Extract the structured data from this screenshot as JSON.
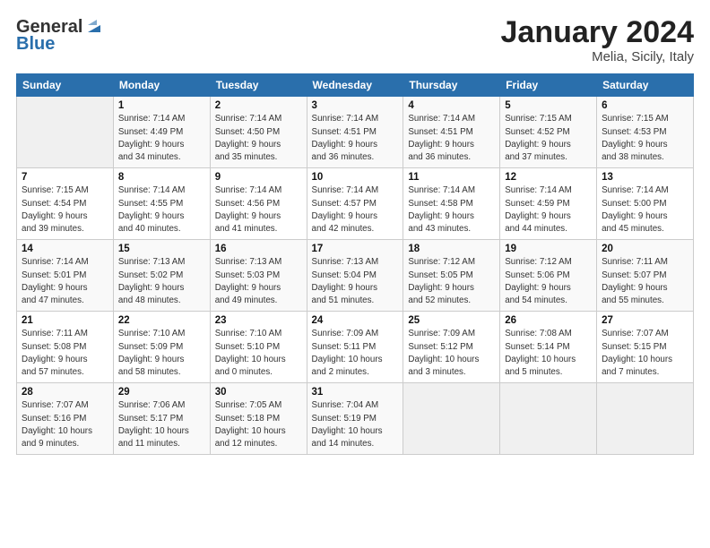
{
  "header": {
    "logo_general": "General",
    "logo_blue": "Blue",
    "title": "January 2024",
    "location": "Melia, Sicily, Italy"
  },
  "columns": [
    "Sunday",
    "Monday",
    "Tuesday",
    "Wednesday",
    "Thursday",
    "Friday",
    "Saturday"
  ],
  "weeks": [
    [
      {
        "day": "",
        "info": ""
      },
      {
        "day": "1",
        "info": "Sunrise: 7:14 AM\nSunset: 4:49 PM\nDaylight: 9 hours\nand 34 minutes."
      },
      {
        "day": "2",
        "info": "Sunrise: 7:14 AM\nSunset: 4:50 PM\nDaylight: 9 hours\nand 35 minutes."
      },
      {
        "day": "3",
        "info": "Sunrise: 7:14 AM\nSunset: 4:51 PM\nDaylight: 9 hours\nand 36 minutes."
      },
      {
        "day": "4",
        "info": "Sunrise: 7:14 AM\nSunset: 4:51 PM\nDaylight: 9 hours\nand 36 minutes."
      },
      {
        "day": "5",
        "info": "Sunrise: 7:15 AM\nSunset: 4:52 PM\nDaylight: 9 hours\nand 37 minutes."
      },
      {
        "day": "6",
        "info": "Sunrise: 7:15 AM\nSunset: 4:53 PM\nDaylight: 9 hours\nand 38 minutes."
      }
    ],
    [
      {
        "day": "7",
        "info": "Sunrise: 7:15 AM\nSunset: 4:54 PM\nDaylight: 9 hours\nand 39 minutes."
      },
      {
        "day": "8",
        "info": "Sunrise: 7:14 AM\nSunset: 4:55 PM\nDaylight: 9 hours\nand 40 minutes."
      },
      {
        "day": "9",
        "info": "Sunrise: 7:14 AM\nSunset: 4:56 PM\nDaylight: 9 hours\nand 41 minutes."
      },
      {
        "day": "10",
        "info": "Sunrise: 7:14 AM\nSunset: 4:57 PM\nDaylight: 9 hours\nand 42 minutes."
      },
      {
        "day": "11",
        "info": "Sunrise: 7:14 AM\nSunset: 4:58 PM\nDaylight: 9 hours\nand 43 minutes."
      },
      {
        "day": "12",
        "info": "Sunrise: 7:14 AM\nSunset: 4:59 PM\nDaylight: 9 hours\nand 44 minutes."
      },
      {
        "day": "13",
        "info": "Sunrise: 7:14 AM\nSunset: 5:00 PM\nDaylight: 9 hours\nand 45 minutes."
      }
    ],
    [
      {
        "day": "14",
        "info": "Sunrise: 7:14 AM\nSunset: 5:01 PM\nDaylight: 9 hours\nand 47 minutes."
      },
      {
        "day": "15",
        "info": "Sunrise: 7:13 AM\nSunset: 5:02 PM\nDaylight: 9 hours\nand 48 minutes."
      },
      {
        "day": "16",
        "info": "Sunrise: 7:13 AM\nSunset: 5:03 PM\nDaylight: 9 hours\nand 49 minutes."
      },
      {
        "day": "17",
        "info": "Sunrise: 7:13 AM\nSunset: 5:04 PM\nDaylight: 9 hours\nand 51 minutes."
      },
      {
        "day": "18",
        "info": "Sunrise: 7:12 AM\nSunset: 5:05 PM\nDaylight: 9 hours\nand 52 minutes."
      },
      {
        "day": "19",
        "info": "Sunrise: 7:12 AM\nSunset: 5:06 PM\nDaylight: 9 hours\nand 54 minutes."
      },
      {
        "day": "20",
        "info": "Sunrise: 7:11 AM\nSunset: 5:07 PM\nDaylight: 9 hours\nand 55 minutes."
      }
    ],
    [
      {
        "day": "21",
        "info": "Sunrise: 7:11 AM\nSunset: 5:08 PM\nDaylight: 9 hours\nand 57 minutes."
      },
      {
        "day": "22",
        "info": "Sunrise: 7:10 AM\nSunset: 5:09 PM\nDaylight: 9 hours\nand 58 minutes."
      },
      {
        "day": "23",
        "info": "Sunrise: 7:10 AM\nSunset: 5:10 PM\nDaylight: 10 hours\nand 0 minutes."
      },
      {
        "day": "24",
        "info": "Sunrise: 7:09 AM\nSunset: 5:11 PM\nDaylight: 10 hours\nand 2 minutes."
      },
      {
        "day": "25",
        "info": "Sunrise: 7:09 AM\nSunset: 5:12 PM\nDaylight: 10 hours\nand 3 minutes."
      },
      {
        "day": "26",
        "info": "Sunrise: 7:08 AM\nSunset: 5:14 PM\nDaylight: 10 hours\nand 5 minutes."
      },
      {
        "day": "27",
        "info": "Sunrise: 7:07 AM\nSunset: 5:15 PM\nDaylight: 10 hours\nand 7 minutes."
      }
    ],
    [
      {
        "day": "28",
        "info": "Sunrise: 7:07 AM\nSunset: 5:16 PM\nDaylight: 10 hours\nand 9 minutes."
      },
      {
        "day": "29",
        "info": "Sunrise: 7:06 AM\nSunset: 5:17 PM\nDaylight: 10 hours\nand 11 minutes."
      },
      {
        "day": "30",
        "info": "Sunrise: 7:05 AM\nSunset: 5:18 PM\nDaylight: 10 hours\nand 12 minutes."
      },
      {
        "day": "31",
        "info": "Sunrise: 7:04 AM\nSunset: 5:19 PM\nDaylight: 10 hours\nand 14 minutes."
      },
      {
        "day": "",
        "info": ""
      },
      {
        "day": "",
        "info": ""
      },
      {
        "day": "",
        "info": ""
      }
    ]
  ]
}
